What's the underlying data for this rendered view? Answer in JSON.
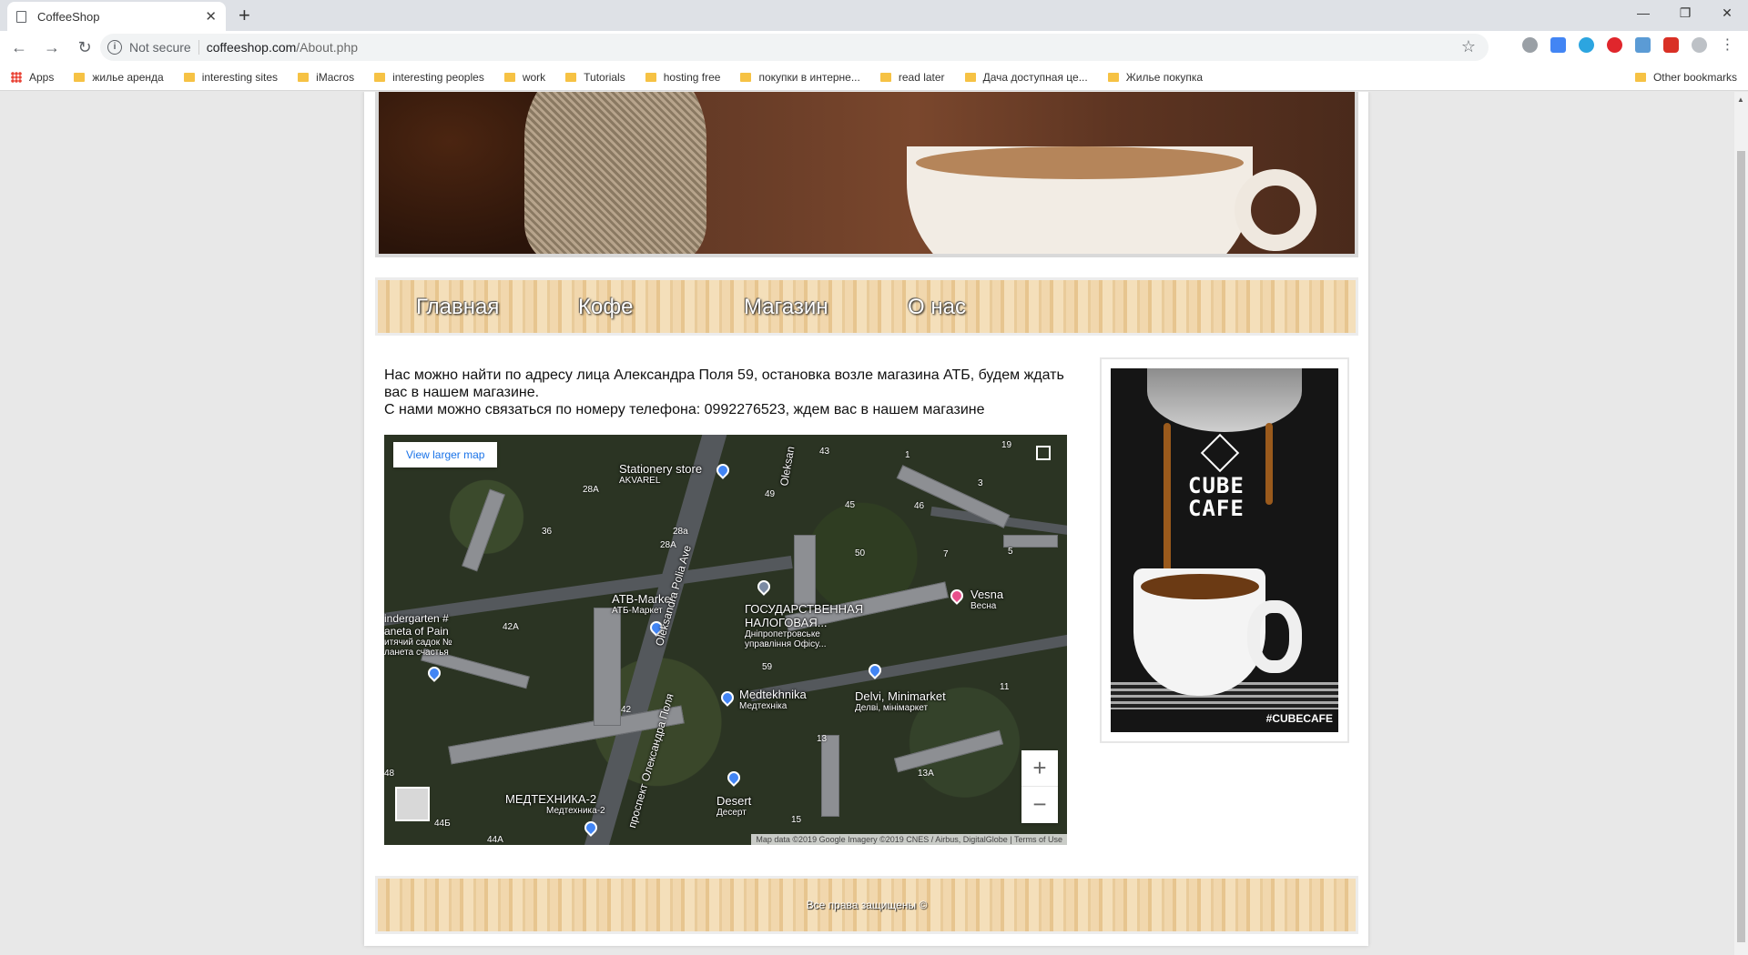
{
  "browser": {
    "tab_title": "CoffeeShop",
    "security_label": "Not secure",
    "url_host": "coffeeshop.com",
    "url_path": "/About.php",
    "bookmarks": [
      "Apps",
      "жилье аренда",
      "interesting sites",
      "iMacros",
      "interesting peoples",
      "work",
      "Tutorials",
      "hosting free",
      "покупки в интерне...",
      "read later",
      "Дача доступная це...",
      "Жилье покупка"
    ],
    "other_bookmarks": "Other bookmarks"
  },
  "nav": {
    "items": [
      "Главная",
      "Кофе",
      "Магазин",
      "О нас"
    ]
  },
  "content": {
    "line1": "Нас можно найти по адресу лица Александра Поля 59, остановка возле магазина АТБ, будем ждать вас в нашем магазине.",
    "line2": "С нами можно связаться по номеру телефона: 0992276523, ждем вас в нашем магазине"
  },
  "map": {
    "view_larger": "View larger map",
    "attribution": "Map data ©2019 Google Imagery ©2019 CNES / Airbus, DigitalGlobe  |  Terms of Use",
    "places": {
      "stationery": "Stationery store",
      "stationery_sub": "AKVAREL",
      "atb": "ATB-Market",
      "atb_sub": "АТБ-Маркет",
      "kindergarten": "indergarten #",
      "kindergarten2": "aneta of Pain",
      "kindergarten_sub": "итячий садок №",
      "kindergarten_sub2": "ланета счастья",
      "tax": "ГОСУДАРСТВЕННАЯ",
      "tax2": "НАЛОГОВАЯ...",
      "tax_sub": "Дніпропетровське",
      "tax_sub2": "управління Офісу...",
      "vesna": "Vesna",
      "vesna_sub": "Весна",
      "medtekhnika": "Medtekhnika",
      "medtekhnika_sub": "Медтехніка",
      "delvi": "Delvi, Minimarket",
      "delvi_sub": "Делві, мінімаркет",
      "med2": "МЕДТЕХНИКА-2",
      "med2_sub": "Медтехника-2",
      "desert": "Desert",
      "desert_sub": "Десерт",
      "avenue": "Oleksandra Polia Ave",
      "avenue_ua": "проспект Олександра Поля",
      "street_top": "Oleksan"
    },
    "numbers": [
      "19",
      "43",
      "1",
      "28A",
      "49",
      "3",
      "45",
      "46",
      "36",
      "28a",
      "28A",
      "7",
      "50",
      "5",
      "42A",
      "59",
      "42",
      "13",
      "13A",
      "48",
      "44Б",
      "44A",
      "15",
      "11"
    ]
  },
  "promo": {
    "brand_line1": "CUBE",
    "brand_line2": "CAFE",
    "hashtag": "#CUBECAFE"
  },
  "footer": {
    "text": "Все права защищены ©"
  }
}
